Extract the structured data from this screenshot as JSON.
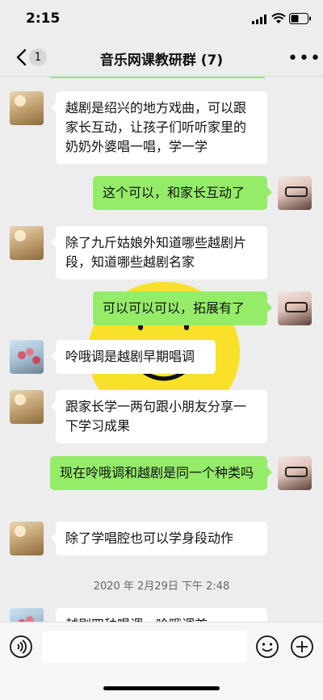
{
  "status": {
    "time": "2:15"
  },
  "nav": {
    "back_count": "1",
    "title": "音乐网课教研群 (7)",
    "more": "•••"
  },
  "messages": [
    {
      "side": "left",
      "avatar": "sun",
      "text": "越剧是绍兴的地方戏曲，可以跟家长互动，让孩子们听听家里的奶奶外婆唱一唱，学一学"
    },
    {
      "side": "right",
      "avatar": "me",
      "text": "这个可以，和家长互动了"
    },
    {
      "side": "left",
      "avatar": "sun",
      "text": "除了九斤姑娘外知道哪些越剧片段，知道哪些越剧名家"
    },
    {
      "side": "right",
      "avatar": "me",
      "text": "可以可以可以，拓展有了"
    },
    {
      "side": "left",
      "avatar": "flower",
      "text": "呤哦调是越剧早期唱调"
    },
    {
      "side": "left",
      "avatar": "sun",
      "text": "跟家长学一两句跟小朋友分享一下学习成果"
    },
    {
      "side": "right",
      "avatar": "me",
      "text": "现在呤哦调和越剧是同一个种类吗"
    },
    {
      "side": "left",
      "avatar": "sun",
      "text": "除了学唱腔也可以学身段动作"
    },
    {
      "side": "left",
      "avatar": "flower",
      "text": "越剧四种唱调，呤哦调首..."
    }
  ],
  "timestamp": "2020 年 2月29日 下午 2:48",
  "input": {
    "placeholder": ""
  },
  "colors": {
    "bg": "#ededed",
    "green_bubble": "#95ec69",
    "white_bubble": "#ffffff"
  }
}
